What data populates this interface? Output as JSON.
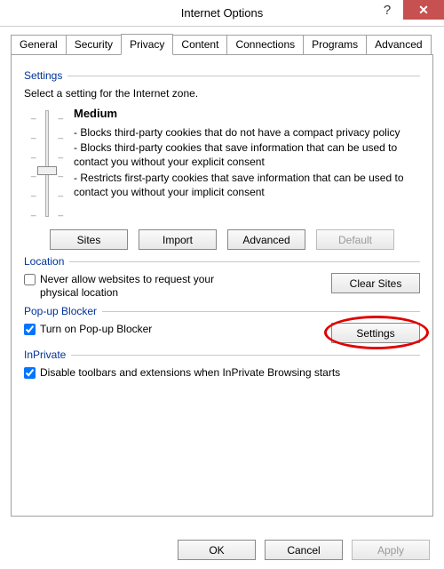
{
  "window": {
    "title": "Internet Options",
    "help_glyph": "?",
    "close_glyph": "✕"
  },
  "tabs": [
    {
      "label": "General"
    },
    {
      "label": "Security"
    },
    {
      "label": "Privacy"
    },
    {
      "label": "Content"
    },
    {
      "label": "Connections"
    },
    {
      "label": "Programs"
    },
    {
      "label": "Advanced"
    }
  ],
  "active_tab": "Privacy",
  "settings": {
    "label": "Settings",
    "zone_text": "Select a setting for the Internet zone.",
    "level": "Medium",
    "bullets": [
      "- Blocks third-party cookies that do not have a compact privacy policy",
      "- Blocks third-party cookies that save information that can be used to contact you without your explicit consent",
      "- Restricts first-party cookies that save information that can be used to contact you without your implicit consent"
    ],
    "buttons": {
      "sites": "Sites",
      "import": "Import",
      "advanced": "Advanced",
      "default": "Default"
    }
  },
  "location": {
    "label": "Location",
    "checkbox_label": "Never allow websites to request your physical location",
    "checked": false,
    "clear_sites": "Clear Sites"
  },
  "popup": {
    "label": "Pop-up Blocker",
    "checkbox_label": "Turn on Pop-up Blocker",
    "checked": true,
    "settings": "Settings"
  },
  "inprivate": {
    "label": "InPrivate",
    "checkbox_label": "Disable toolbars and extensions when InPrivate Browsing starts",
    "checked": true
  },
  "footer": {
    "ok": "OK",
    "cancel": "Cancel",
    "apply": "Apply"
  }
}
